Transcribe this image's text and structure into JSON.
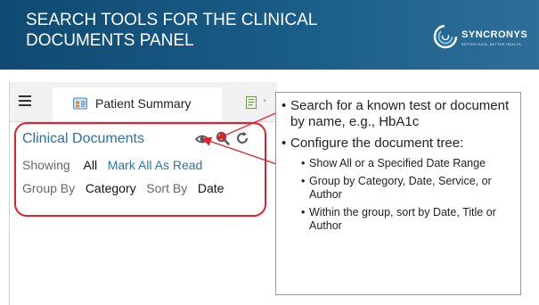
{
  "slide": {
    "title": "SEARCH TOOLS FOR THE CLINICAL DOCUMENTS PANEL",
    "brand": {
      "name": "SYNCRONYS",
      "tagline": "BETTER DATA. BETTER HEALTH.",
      "logo_icon": "swirl-logo-icon"
    },
    "header_color": "#1a5d88"
  },
  "app": {
    "menu_icon": "hamburger-icon",
    "tabs": [
      {
        "label": "Patient Summary",
        "icon": "patient-card-icon",
        "active": true
      },
      {
        "label": "",
        "icon": "document-list-icon",
        "active": false
      }
    ],
    "panel": {
      "title": "Clinical Documents",
      "icons": [
        "eye-icon",
        "search-icon",
        "refresh-icon"
      ],
      "showing_label": "Showing",
      "showing_value": "All",
      "mark_all_link": "Mark All As Read",
      "group_by_label": "Group By",
      "group_by_value": "Category",
      "sort_by_label": "Sort By",
      "sort_by_value": "Date"
    },
    "link_color": "#2f6fb1",
    "highlight_color": "#e5202a"
  },
  "callout": {
    "items": [
      {
        "text": "Search for a known test or document by name, e.g., HbA1c",
        "sub": []
      },
      {
        "text": "Configure the document tree:",
        "sub": [
          "Show All or a Specified Date Range",
          "Group by Category, Date, Service, or Author",
          "Within the group, sort by Date, Title or Author"
        ]
      }
    ]
  }
}
